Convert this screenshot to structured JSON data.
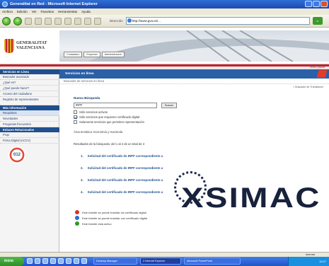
{
  "window": {
    "title": "Generalitat en Red - Microsoft Internet Explorer"
  },
  "menu": [
    "Archivo",
    "Edición",
    "Ver",
    "Favoritos",
    "Herramientas",
    "Ayuda"
  ],
  "address": {
    "label": "Dirección",
    "url": "http://www.gva.es/...",
    "go_label": "Ir"
  },
  "logo": {
    "line1": "GENERALITAT",
    "line2": "VALENCIANA"
  },
  "banner_nav": [
    "Ciudadano",
    "Empresa",
    "Administración"
  ],
  "top_help": "Inicio | Ayuda",
  "sidebar": {
    "section1": "Servicios en Línea",
    "items1": [
      "Buscador avanzado",
      "¿Qué es?",
      "¿Qué puedo hacer?",
      "Acceso del ciudadano",
      "Registro de representantes"
    ],
    "section2": "Más información",
    "items2": [
      "Requisitos",
      "Novedades",
      "Preguntas frecuentes"
    ],
    "section3": "Enlaces Relacionados",
    "items3": [
      "Prop",
      "Firma Digital (ACCV)"
    ],
    "badge": "012"
  },
  "main": {
    "header": "Servicios en línea",
    "breadcrumb": "Buscador de servicios en línea",
    "right_link": "< Buscador de Tramitación",
    "new_search": "Nueva Búsqueda",
    "search_value": "IRPF",
    "search_button": "Buscar",
    "checks": [
      {
        "label": "Sólo servicios activos",
        "checked": false
      },
      {
        "label": "Sólo servicios que requieren certificado digital",
        "checked": true
      },
      {
        "label": "Solamente servicios que permiten representación",
        "checked": false
      }
    ],
    "area": "Área temática: Economía y Hacienda",
    "results_line": "Resultados de la búsqueda: del 1 al 4 de un total de 4",
    "results": [
      {
        "num": "1.",
        "label": "Solicitud del certificado de IRPF correspondiente a"
      },
      {
        "num": "2.",
        "label": "Solicitud del certificado de IRPF correspondiente a"
      },
      {
        "num": "3.",
        "label": "Solicitud del certificado de IRPF correspondiente a"
      },
      {
        "num": "4.",
        "label": "Solicitud del certificado de IRPF correspondiente a"
      }
    ],
    "legend": [
      {
        "label": "Este trámite se puede tramitar sin certificado digital",
        "color": "#d9302a"
      },
      {
        "label": "Este trámite se puede tramitar con certificado digital",
        "color": "#2a6ad9"
      },
      {
        "label": "Este trámite está activo",
        "color": "#2a9a2a"
      }
    ]
  },
  "watermark": {
    "text": "XSIMAC"
  },
  "status": {
    "zone": "Internet"
  },
  "taskbar": {
    "start": "Inicio",
    "tasks": [
      "Desktop Manager",
      "2 Internet Explorer",
      "Microsoft PowerPoint"
    ],
    "clock": "10:07"
  },
  "colors": {
    "accent": "#2b5fa8",
    "brand_red": "#c8202a"
  }
}
